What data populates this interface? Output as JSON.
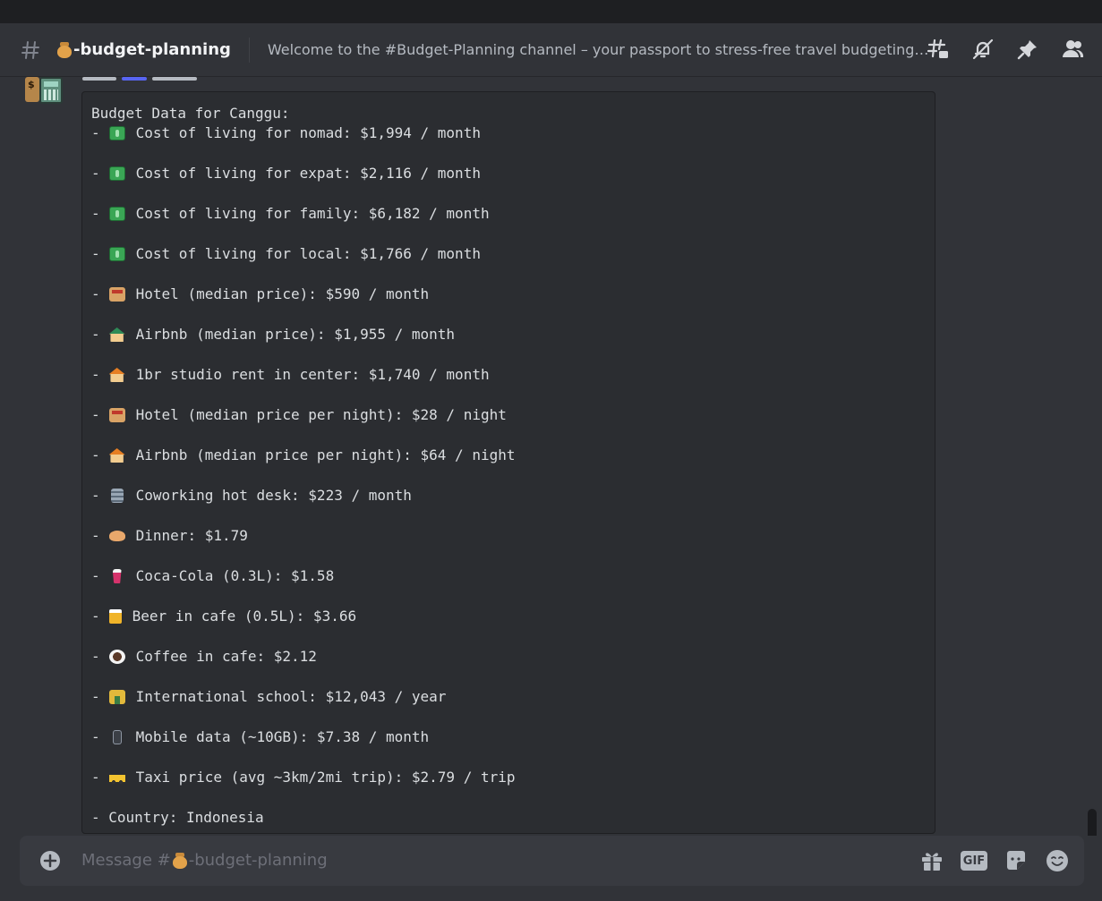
{
  "channel": {
    "name": "-budget-planning",
    "topic": "Welcome to the #Budget-Planning channel – your passport to stress-free travel budgeting! Whet…"
  },
  "message": {
    "block_title": "Budget Data for Canggu:",
    "lines": [
      {
        "icon": "dollar-banknote-icon",
        "text": "Cost of living for nomad: $1,994 / month"
      },
      {
        "icon": "dollar-banknote-icon",
        "text": "Cost of living for expat: $2,116 / month"
      },
      {
        "icon": "dollar-banknote-icon",
        "text": "Cost of living for family: $6,182 / month"
      },
      {
        "icon": "dollar-banknote-icon",
        "text": "Cost of living for local: $1,766 / month"
      },
      {
        "icon": "hotel-icon",
        "text": "Hotel (median price): $590 / month"
      },
      {
        "icon": "house-with-garden-icon",
        "text": "Airbnb (median price): $1,955 / month"
      },
      {
        "icon": "house-icon",
        "text": "1br studio rent in center: $1,740 / month"
      },
      {
        "icon": "hotel-icon",
        "text": "Hotel (median price per night): $28 / night"
      },
      {
        "icon": "house-icon",
        "text": "Airbnb (median price per night): $64 / night"
      },
      {
        "icon": "office-building-icon",
        "text": "Coworking hot desk: $223 / month"
      },
      {
        "icon": "dinner-icon",
        "text": "Dinner: $1.79"
      },
      {
        "icon": "soda-cup-icon",
        "text": "Coca-Cola (0.3L): $1.58"
      },
      {
        "icon": "beer-mug-icon",
        "text": "Beer in cafe (0.5L): $3.66"
      },
      {
        "icon": "coffee-icon",
        "text": "Coffee in cafe: $2.12"
      },
      {
        "icon": "school-icon",
        "text": "International school: $12,043 / year"
      },
      {
        "icon": "mobile-phone-icon",
        "text": "Mobile data (~10GB): $7.38 / month"
      },
      {
        "icon": "taxi-icon",
        "text": "Taxi price (avg ~3km/2mi trip): $2.79 / trip"
      }
    ],
    "country_line": "- Country: Indonesia",
    "bullet": "-"
  },
  "composer": {
    "placeholder_prefix": "Message #",
    "placeholder_suffix": "-budget-planning",
    "gif_label": "GIF"
  },
  "avatar": {
    "label": "$"
  },
  "colors": {
    "background": "#313338",
    "code_block": "#2b2d31",
    "composer": "#383a40"
  }
}
